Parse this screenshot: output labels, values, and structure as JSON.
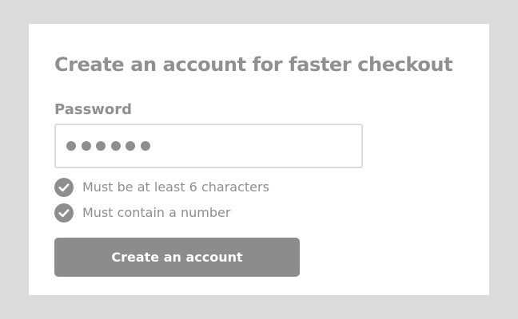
{
  "form": {
    "title": "Create an account for faster checkout",
    "password_label": "Password",
    "password_value": "••••••",
    "password_length": 6,
    "rules": [
      {
        "text": "Must be at least 6 characters",
        "met": true
      },
      {
        "text": "Must contain a number",
        "met": true
      }
    ],
    "submit_label": "Create an account"
  },
  "colors": {
    "page_background": "#dcdcdc",
    "card_background": "#ffffff",
    "text": "#909090",
    "button_background": "#8c8c8c",
    "button_text": "#ffffff",
    "check_icon": "#8e8e8e"
  },
  "icons": {
    "rule_icon": "check-circle-icon"
  }
}
